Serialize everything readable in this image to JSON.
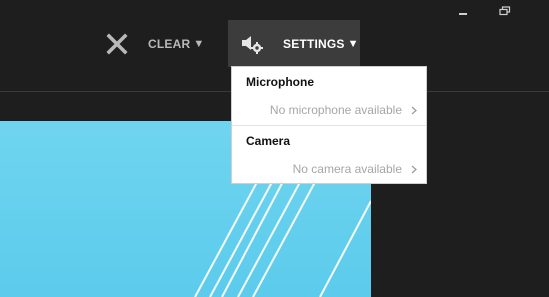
{
  "toolbar": {
    "clear_label": "CLEAR",
    "settings_label": "SETTINGS"
  },
  "dropdown": {
    "microphone": {
      "title": "Microphone",
      "status": "No microphone available"
    },
    "camera": {
      "title": "Camera",
      "status": "No camera available"
    }
  },
  "window_controls": [
    "minimize-icon",
    "restore-icon"
  ],
  "icons": {
    "clear": "close-icon",
    "settings": "speaker-gear-icon",
    "caret": "caret-down-icon",
    "chevron": "chevron-right-icon"
  },
  "colors": {
    "background": "#1e1e1e",
    "settings_button": "#3c3c3c",
    "preview": "#5ccbec",
    "muted_text": "#a6a6a6"
  }
}
